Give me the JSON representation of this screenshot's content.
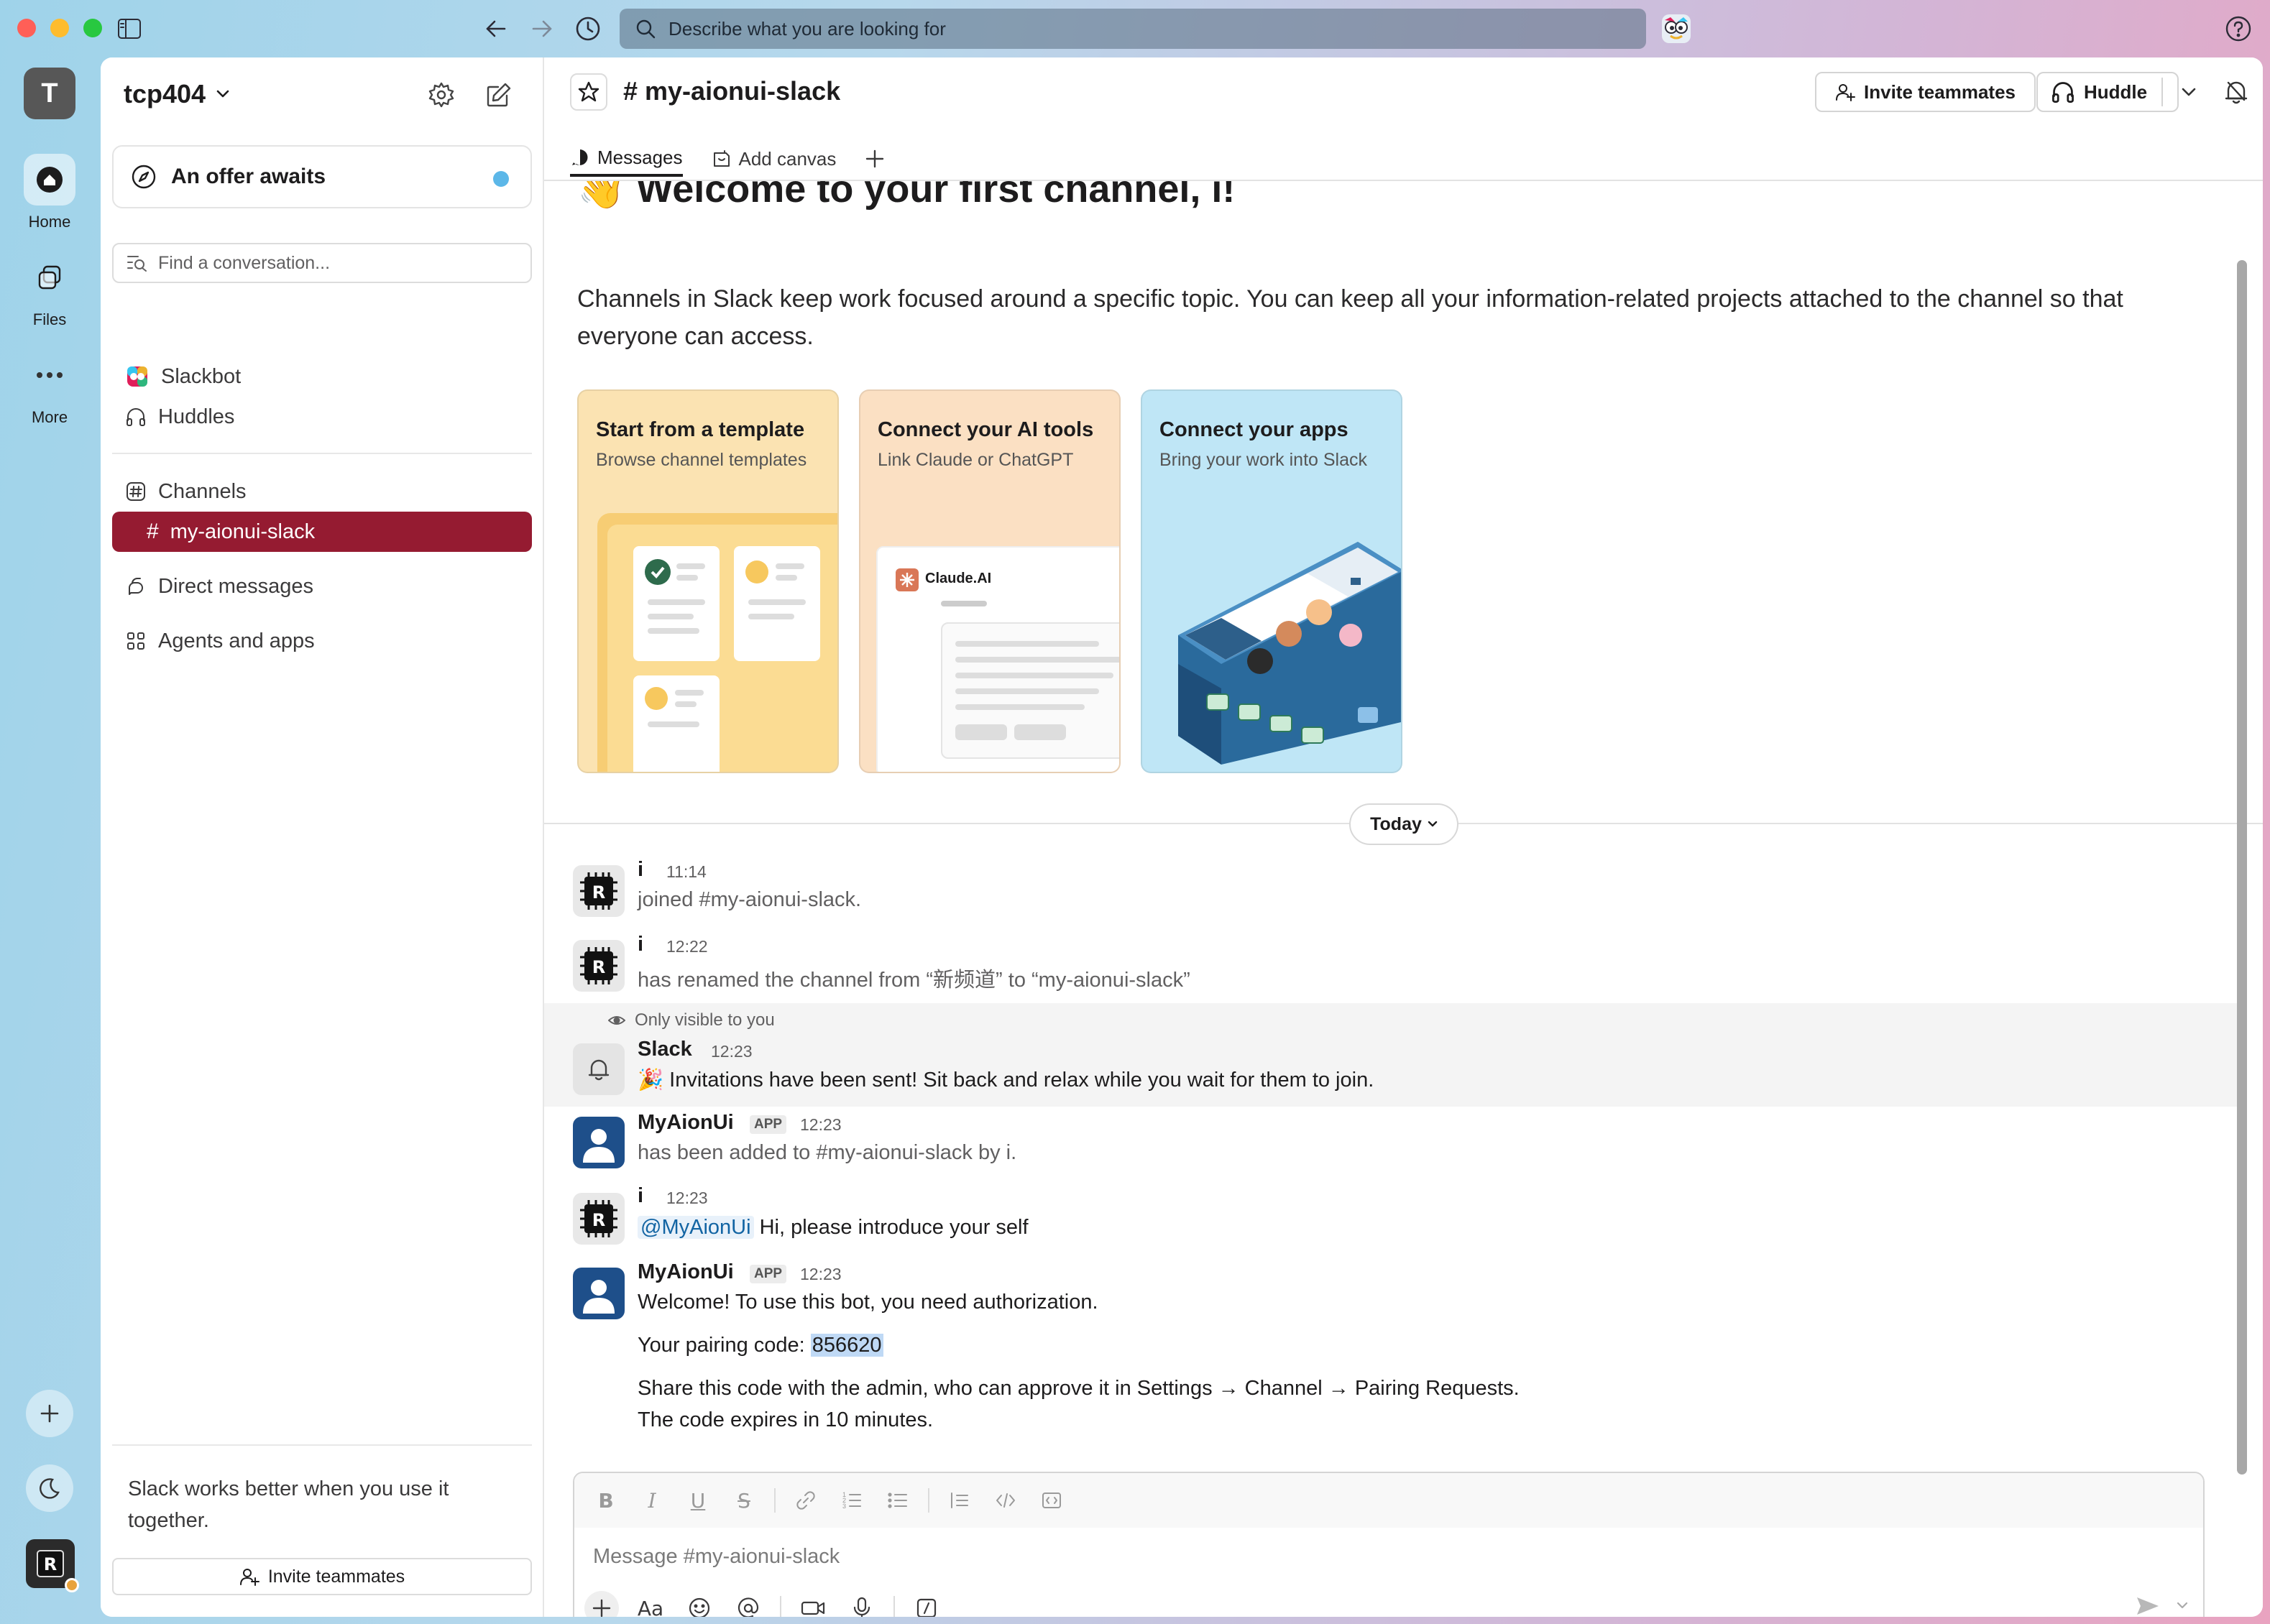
{
  "titlebar": {
    "search_placeholder": "Describe what you are looking for"
  },
  "rail": {
    "workspace_initial": "T",
    "home_label": "Home",
    "files_label": "Files",
    "more_label": "More"
  },
  "sidebar": {
    "workspace_name": "tcp404",
    "offer": "An offer awaits",
    "find_placeholder": "Find a conversation...",
    "slackbot": "Slackbot",
    "huddles": "Huddles",
    "channels": "Channels",
    "active_channel": "my-aionui-slack",
    "direct_messages": "Direct messages",
    "agents": "Agents and apps",
    "footer_text": "Slack works better when you use it together.",
    "invite": "Invite teammates"
  },
  "header": {
    "channel": "# my-aionui-slack",
    "invite": "Invite teammates",
    "huddle": "Huddle",
    "tabs": [
      "Messages",
      "Add canvas"
    ]
  },
  "welcome": {
    "title": "👋 Welcome to your first channel, i!",
    "description": "Channels in Slack keep work focused around a specific topic. You can keep all your information-related projects attached to the channel so that everyone can access."
  },
  "cards": [
    {
      "title": "Start from a template",
      "subtitle": "Browse channel templates",
      "color": "#fbe3b2"
    },
    {
      "title": "Connect your AI tools",
      "subtitle": "Link Claude or ChatGPT",
      "color": "#fbe0c3"
    },
    {
      "title": "Connect your apps",
      "subtitle": "Bring your work into Slack",
      "color": "#bfe6f6"
    }
  ],
  "card_art": {
    "claude_label": "Claude.AI"
  },
  "day_divider": "Today",
  "messages": [
    {
      "author": "i",
      "time": "11:14",
      "text": "joined #my-aionui-slack."
    },
    {
      "author": "i",
      "time": "12:22",
      "text": "has renamed the channel from “新频道” to “my-aionui-slack”"
    },
    {
      "note": "Only visible to you",
      "author": "Slack",
      "time": "12:23",
      "text": "🎉 Invitations have been sent! Sit back and relax while you wait for them to join."
    },
    {
      "author": "MyAionUi",
      "badge": "APP",
      "time": "12:23",
      "text": "has been added to #my-aionui-slack by i."
    },
    {
      "author": "i",
      "time": "12:23",
      "mention": "@MyAionUi",
      "text": " Hi, please introduce your self"
    },
    {
      "author": "MyAionUi",
      "badge": "APP",
      "time": "12:23",
      "line1": "Welcome! To use this bot, you need authorization.",
      "line2_prefix": "Your pairing code: ",
      "code": "856620",
      "line3": "Share this code with the admin, who can approve it in Settings → Channel → Pairing Requests.",
      "line4": "The code expires in 10 minutes."
    }
  ],
  "composer": {
    "placeholder": "Message #my-aionui-slack"
  },
  "colors": {
    "selected_channel": "#951b31",
    "app_avatar": "#1e4f8a",
    "mention": "#1264a3"
  }
}
